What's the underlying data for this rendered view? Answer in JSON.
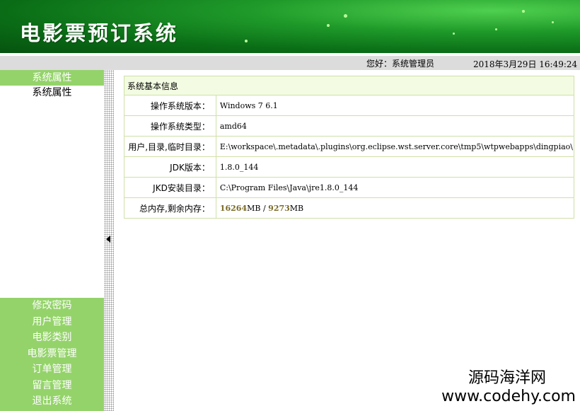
{
  "header": {
    "title": "电影票预订系统"
  },
  "topbar": {
    "greeting": "您好：系统管理员",
    "datetime": "2018年3月29日 16:49:24"
  },
  "sidebar": {
    "section_header": "系统属性",
    "active_item": "系统属性",
    "items": [
      "修改密码",
      "用户管理",
      "电影类别",
      "电影票管理",
      "订单管理",
      "留言管理",
      "退出系统"
    ]
  },
  "main": {
    "table_title": "系统基本信息",
    "rows": [
      {
        "label": "操作系统版本：",
        "value": "Windows 7  6.1"
      },
      {
        "label": "操作系统类型：",
        "value": "amd64"
      },
      {
        "label": "用户,目录,临时目录：",
        "value": "E:\\workspace\\.metadata\\.plugins\\org.eclipse.wst.server.core\\tmp5\\wtpwebapps\\dingpiao\\"
      },
      {
        "label": "JDK版本：",
        "value": "1.8.0_144"
      },
      {
        "label": "JKD安装目录：",
        "value": "C:\\Program Files\\Java\\jre1.8.0_144"
      },
      {
        "label": "总内存,剩余内存："
      }
    ],
    "memory": {
      "total": "16264",
      "free": "9273",
      "unit": "MB",
      "sep": " / "
    }
  },
  "watermark": {
    "line1": "源码海洋网",
    "line2": "www.codehy.com"
  },
  "colors": {
    "header_green": "#0a6d16",
    "menu_green": "#94d36a",
    "table_border": "#cfe0a8",
    "table_head_bg": "#f3fce2"
  }
}
